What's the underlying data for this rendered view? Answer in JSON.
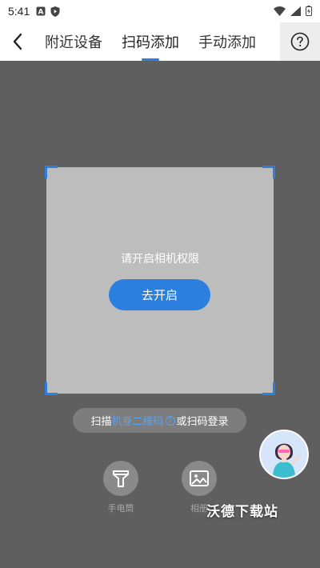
{
  "status_bar": {
    "time": "5:41"
  },
  "nav": {
    "back_icon": "chevron-left-icon",
    "tabs": [
      {
        "label": "附近设备",
        "active": false
      },
      {
        "label": "扫码添加",
        "active": true
      },
      {
        "label": "手动添加",
        "active": false
      }
    ],
    "help_icon": "question-circle-icon"
  },
  "scanner": {
    "permission_text": "请开启相机权限",
    "open_button_label": "去开启",
    "accent_color": "#2b7fde"
  },
  "hint": {
    "prefix": "扫描",
    "link": "机身二维码",
    "suffix": "或扫码登录"
  },
  "tools": {
    "flashlight_label": "手电筒",
    "album_label": "相册"
  },
  "assistant_icon": "assistant-avatar",
  "watermark": "沃德下载站"
}
